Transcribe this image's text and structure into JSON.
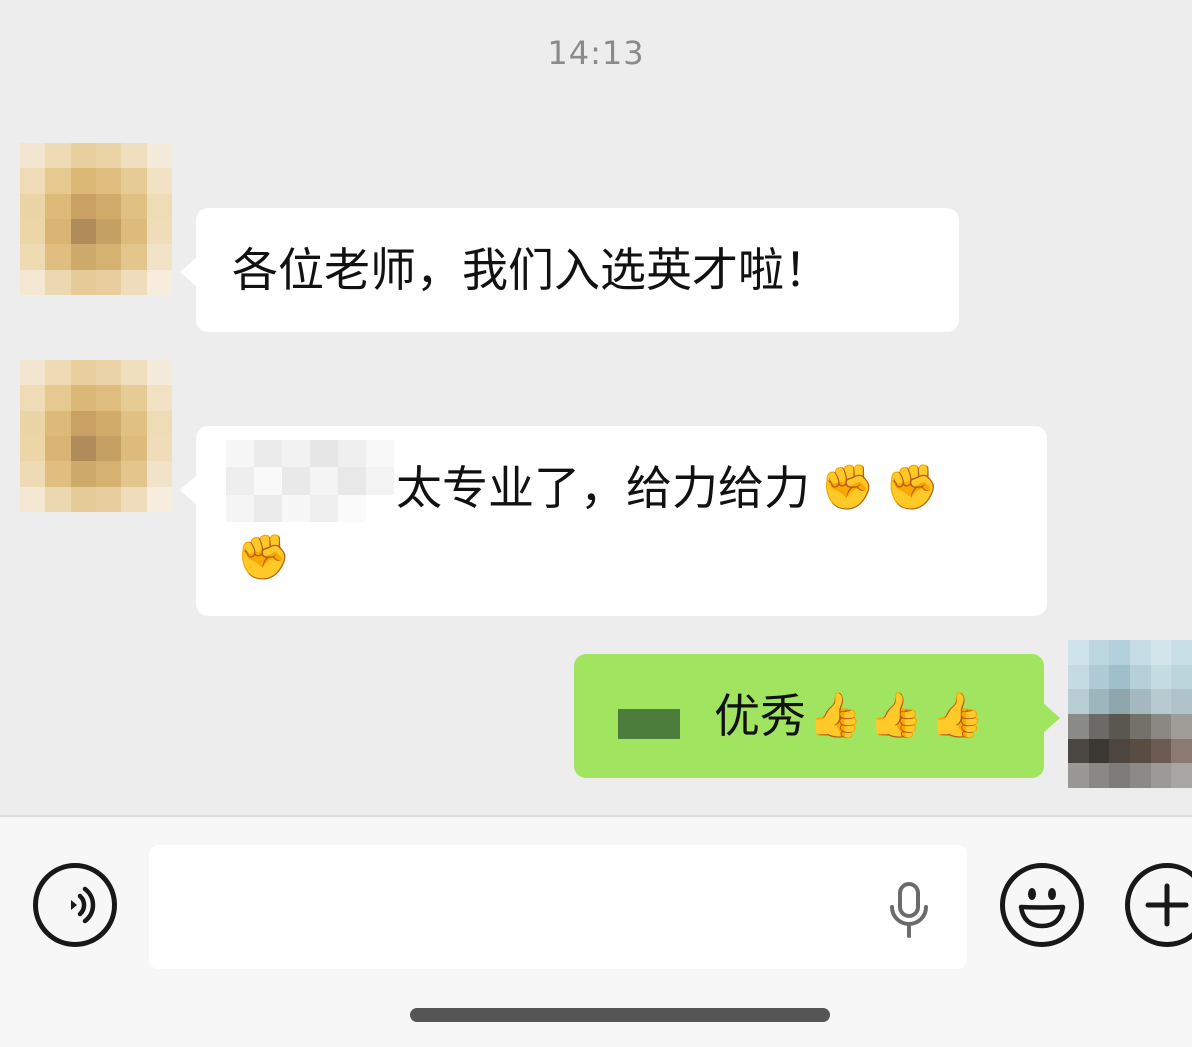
{
  "chat": {
    "timestamp": "14:13",
    "messages": [
      {
        "side": "left",
        "text": "各位老师，我们入选英才啦！"
      },
      {
        "side": "left",
        "text": "太专业了，给力给力",
        "emojis": [
          "✊",
          "✊",
          "✊"
        ]
      },
      {
        "side": "right",
        "text": "优秀",
        "emojis": [
          "👍",
          "👍",
          "👍"
        ]
      }
    ]
  },
  "input_bar": {
    "voice_icon": "voice-toggle-icon",
    "mic_icon": "microphone-icon",
    "emoji_icon": "emoji-smile-icon",
    "plus_icon": "plus-icon",
    "input_value": ""
  },
  "colors": {
    "background": "#ededed",
    "sent_bubble": "#a0e45f",
    "received_bubble": "#ffffff"
  }
}
